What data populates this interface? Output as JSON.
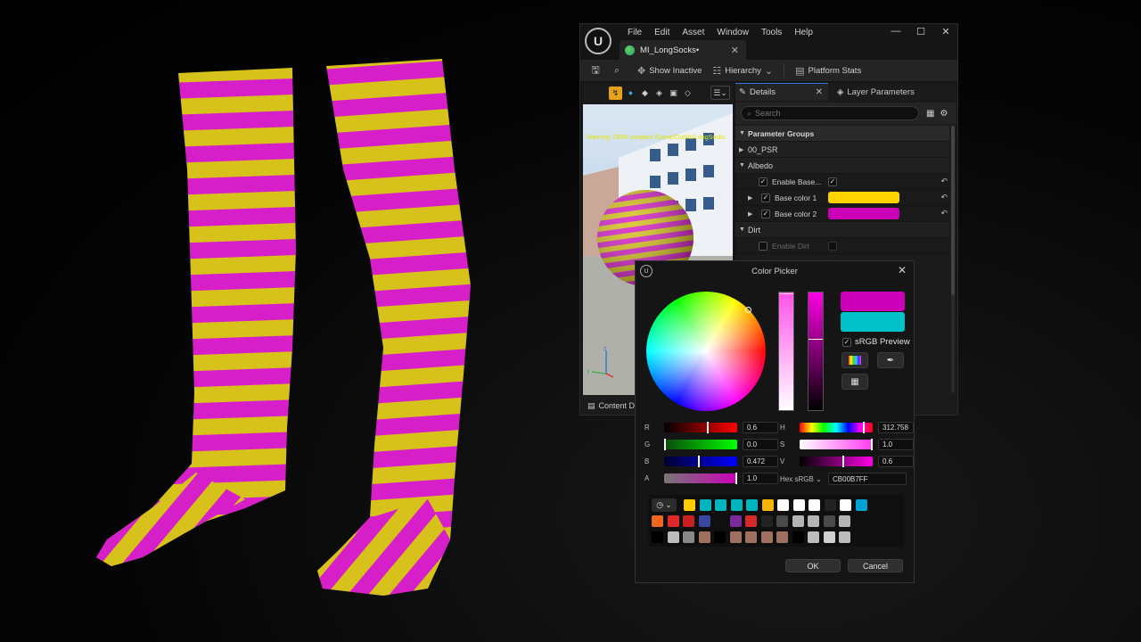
{
  "menu": [
    "File",
    "Edit",
    "Asset",
    "Window",
    "Tools",
    "Help"
  ],
  "window_controls": {
    "minimize": "—",
    "maximize": "☐",
    "close": "✕"
  },
  "doc_tab": {
    "label": "MI_LongSocks•"
  },
  "toolbar": {
    "show_inactive": "Show Inactive",
    "hierarchy": "Hierarchy",
    "platform_stats": "Platform Stats"
  },
  "viewport": {
    "warning": "Warning: ORM samples /Game/Outfits/LongSocks"
  },
  "content_drawer": "Content Dr",
  "details": {
    "tab_details": "Details",
    "tab_layer": "Layer Parameters",
    "search_placeholder": "Search",
    "group": "Parameter Groups",
    "cat_psr": "00_PSR",
    "cat_albedo": "Albedo",
    "enable_base": "Enable Base...",
    "base_color_1": "Base color 1",
    "base_color_2": "Base color 2",
    "cat_dirt": "Dirt",
    "enable_dirt": "Enable Dirt",
    "base_color_1_value": "#ffd400",
    "base_color_2_value": "#cb00b7"
  },
  "picker": {
    "title": "Color Picker",
    "srgb_preview": "sRGB Preview",
    "r": {
      "label": "R",
      "value": "0.6"
    },
    "g": {
      "label": "G",
      "value": "0.0"
    },
    "b": {
      "label": "B",
      "value": "0.472"
    },
    "a": {
      "label": "A",
      "value": "1.0"
    },
    "h": {
      "label": "H",
      "value": "312.758"
    },
    "s": {
      "label": "S",
      "value": "1.0"
    },
    "v": {
      "label": "V",
      "value": "0.6"
    },
    "hex_label": "Hex sRGB",
    "hex_value": "CB00B7FF",
    "ok": "OK",
    "cancel": "Cancel",
    "new_color": "#cb00b7",
    "old_color": "#00c0c8"
  },
  "theme_colors": [
    [
      "#ffcc00",
      "#ffcc00",
      "#00b5c0",
      "#00b5c0",
      "#00b5c0",
      "#00b5c0",
      "#f7b500",
      "#ffffff",
      "#ffffff",
      "#ffffff",
      "#222222",
      "#ffffff",
      "#00a3d6"
    ],
    [
      "#f0681e",
      "#e02828",
      "#c82020",
      "#3a46a0",
      "#111111",
      "#7a2a9a",
      "#d42a2a",
      "#222222",
      "#4a4a4a",
      "#b4b4b4",
      "#b4b4b4",
      "#4a4a4a",
      "#b4b4b4"
    ],
    [
      "#000000",
      "#bcbcbc",
      "#888888",
      "#a07060",
      "#000000",
      "#a07060",
      "#a07060",
      "#a07060",
      "#a07060",
      "#000000",
      "#bcbcbc",
      "#d0d0d0",
      "#bcbcbc"
    ]
  ]
}
